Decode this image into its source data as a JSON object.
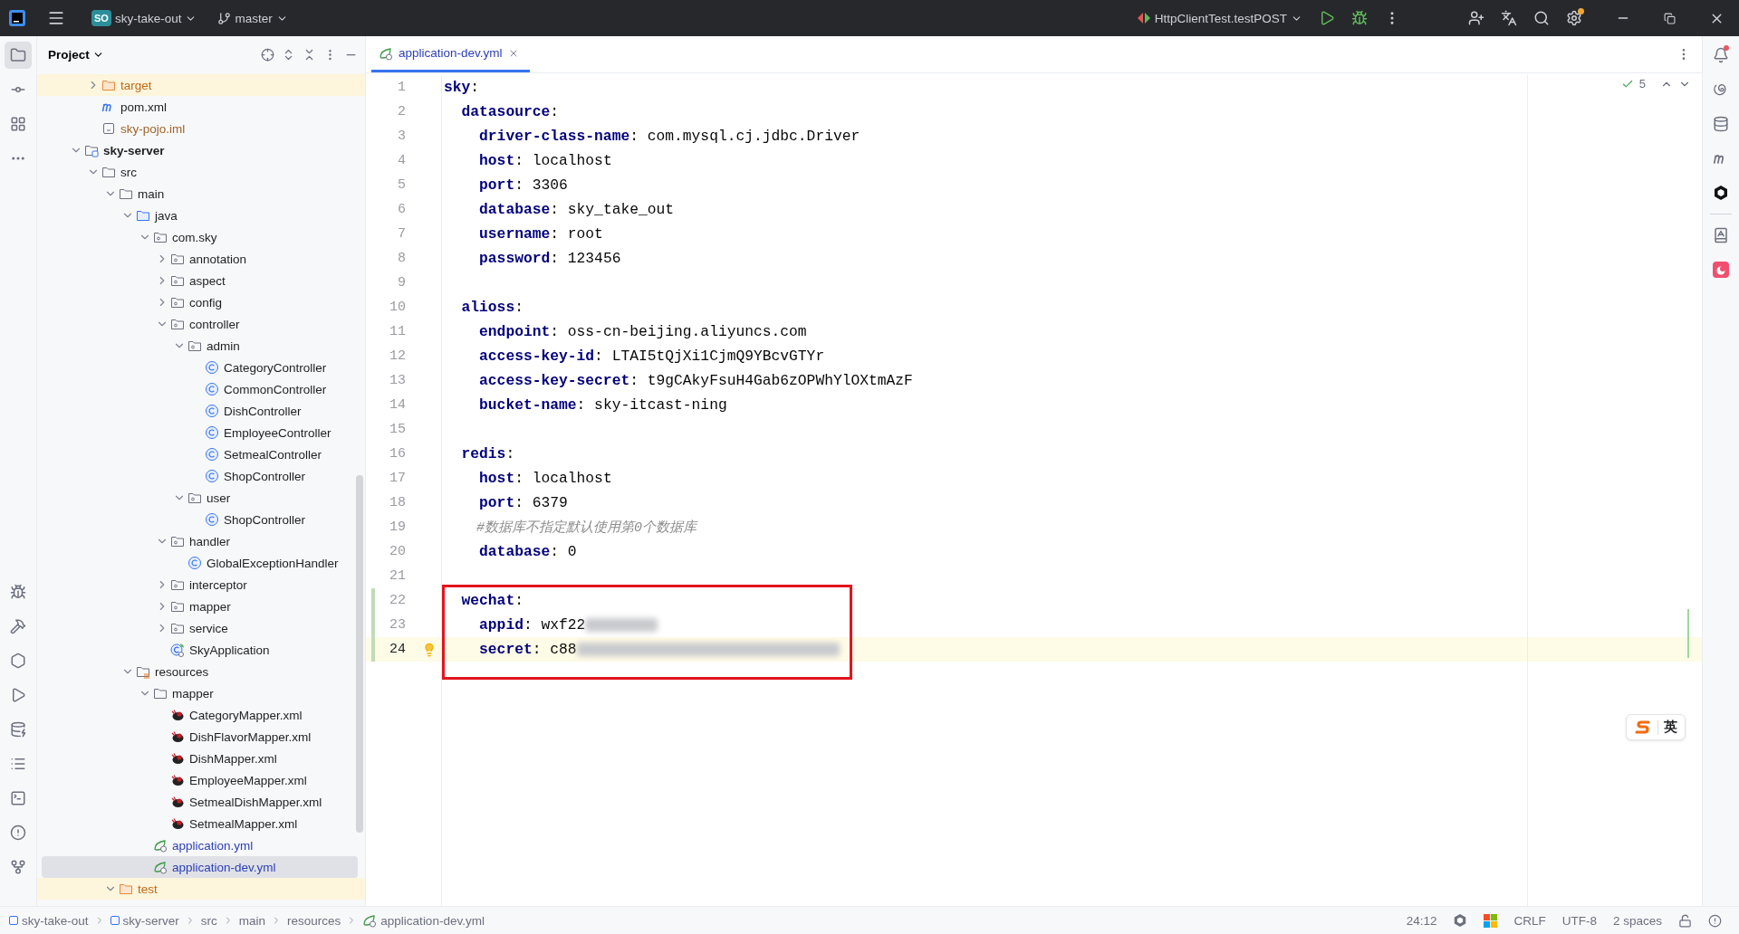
{
  "title_bar": {
    "project_badge": "SO",
    "project": "sky-take-out",
    "branch": "master",
    "run_config": "HttpClientTest.testPOST",
    "settings_badge": true
  },
  "project_panel": {
    "title": "Project"
  },
  "tree": [
    {
      "kind": "hidden-parent",
      "children": [
        {
          "label": "target",
          "kind": "folder",
          "excluded": true,
          "expanded": false,
          "selected": false
        },
        {
          "label": "pom.xml",
          "kind": "maven",
          "selected": false
        },
        {
          "label": "sky-pojo.iml",
          "kind": "iml",
          "selected": false
        }
      ]
    },
    {
      "label": "sky-server",
      "kind": "module",
      "expanded": true,
      "selected": false,
      "children": [
        {
          "label": "src",
          "kind": "folder",
          "expanded": true,
          "selected": false,
          "children": [
            {
              "label": "main",
              "kind": "folder",
              "expanded": true,
              "selected": false,
              "children": [
                {
                  "label": "java",
                  "kind": "source",
                  "expanded": true,
                  "selected": false,
                  "children": [
                    {
                      "label": "com.sky",
                      "kind": "package",
                      "expanded": true,
                      "selected": false,
                      "children": [
                        {
                          "label": "annotation",
                          "kind": "package",
                          "expanded": false,
                          "selected": false
                        },
                        {
                          "label": "aspect",
                          "kind": "package",
                          "expanded": false,
                          "selected": false
                        },
                        {
                          "label": "config",
                          "kind": "package",
                          "expanded": false,
                          "selected": false
                        },
                        {
                          "label": "controller",
                          "kind": "package",
                          "expanded": true,
                          "selected": false,
                          "children": [
                            {
                              "label": "admin",
                              "kind": "package",
                              "expanded": true,
                              "selected": false,
                              "children": [
                                {
                                  "label": "CategoryController",
                                  "kind": "class",
                                  "selected": false
                                },
                                {
                                  "label": "CommonController",
                                  "kind": "class",
                                  "selected": false
                                },
                                {
                                  "label": "DishController",
                                  "kind": "class",
                                  "selected": false
                                },
                                {
                                  "label": "EmployeeController",
                                  "kind": "class",
                                  "selected": false
                                },
                                {
                                  "label": "SetmealController",
                                  "kind": "class",
                                  "selected": false
                                },
                                {
                                  "label": "ShopController",
                                  "kind": "class",
                                  "selected": false
                                }
                              ]
                            },
                            {
                              "label": "user",
                              "kind": "package",
                              "expanded": true,
                              "selected": false,
                              "children": [
                                {
                                  "label": "ShopController",
                                  "kind": "class",
                                  "selected": false
                                }
                              ]
                            }
                          ]
                        },
                        {
                          "label": "handler",
                          "kind": "package",
                          "expanded": true,
                          "selected": false,
                          "children": [
                            {
                              "label": "GlobalExceptionHandler",
                              "kind": "class",
                              "selected": false
                            }
                          ]
                        },
                        {
                          "label": "interceptor",
                          "kind": "package",
                          "expanded": false,
                          "selected": false
                        },
                        {
                          "label": "mapper",
                          "kind": "package",
                          "expanded": false,
                          "selected": false
                        },
                        {
                          "label": "service",
                          "kind": "package",
                          "expanded": false,
                          "selected": false
                        },
                        {
                          "label": "SkyApplication",
                          "kind": "app",
                          "selected": false
                        }
                      ]
                    }
                  ]
                },
                {
                  "label": "resources",
                  "kind": "resources",
                  "expanded": true,
                  "selected": false,
                  "children": [
                    {
                      "label": "mapper",
                      "kind": "folder",
                      "expanded": true,
                      "selected": false,
                      "children": [
                        {
                          "label": "CategoryMapper.xml",
                          "kind": "mybatis",
                          "selected": false
                        },
                        {
                          "label": "DishFlavorMapper.xml",
                          "kind": "mybatis",
                          "selected": false
                        },
                        {
                          "label": "DishMapper.xml",
                          "kind": "mybatis",
                          "selected": false
                        },
                        {
                          "label": "EmployeeMapper.xml",
                          "kind": "mybatis",
                          "selected": false
                        },
                        {
                          "label": "SetmealDishMapper.xml",
                          "kind": "mybatis",
                          "selected": false
                        },
                        {
                          "label": "SetmealMapper.xml",
                          "kind": "mybatis",
                          "selected": false
                        }
                      ]
                    },
                    {
                      "label": "application.yml",
                      "kind": "yml",
                      "selected": false
                    },
                    {
                      "label": "application-dev.yml",
                      "kind": "yml",
                      "selected": true
                    }
                  ]
                }
              ]
            },
            {
              "label": "test",
              "kind": "folder",
              "excluded": true,
              "expanded": true,
              "selected": false
            }
          ]
        }
      ]
    }
  ],
  "tabs": [
    {
      "label": "application-dev.yml",
      "selected": true
    }
  ],
  "inspection": {
    "count": "5"
  },
  "code": [
    {
      "number": "1",
      "tokens": [
        {
          "kind": "key",
          "text": "sky"
        },
        {
          "kind": "punct",
          "text": ":"
        }
      ]
    },
    {
      "number": "2",
      "tokens": [
        {
          "kind": "key",
          "text": "  datasource"
        },
        {
          "kind": "punct",
          "text": ":"
        }
      ]
    },
    {
      "number": "3",
      "tokens": [
        {
          "kind": "key",
          "text": "    driver-class-name"
        },
        {
          "kind": "punct",
          "text": ":"
        },
        {
          "kind": "value",
          "text": " com.mysql.cj.jdbc.Driver"
        }
      ]
    },
    {
      "number": "4",
      "tokens": [
        {
          "kind": "key",
          "text": "    host"
        },
        {
          "kind": "punct",
          "text": ":"
        },
        {
          "kind": "value",
          "text": " localhost"
        }
      ]
    },
    {
      "number": "5",
      "tokens": [
        {
          "kind": "key",
          "text": "    port"
        },
        {
          "kind": "punct",
          "text": ":"
        },
        {
          "kind": "value",
          "text": " 3306"
        }
      ]
    },
    {
      "number": "6",
      "tokens": [
        {
          "kind": "key",
          "text": "    database"
        },
        {
          "kind": "punct",
          "text": ":"
        },
        {
          "kind": "value",
          "text": " sky_take_out"
        }
      ]
    },
    {
      "number": "7",
      "tokens": [
        {
          "kind": "key",
          "text": "    username"
        },
        {
          "kind": "punct",
          "text": ":"
        },
        {
          "kind": "value",
          "text": " root"
        }
      ]
    },
    {
      "number": "8",
      "tokens": [
        {
          "kind": "key",
          "text": "    password"
        },
        {
          "kind": "punct",
          "text": ":"
        },
        {
          "kind": "value",
          "text": " 123456"
        }
      ]
    },
    {
      "number": "9"
    },
    {
      "number": "10",
      "tokens": [
        {
          "kind": "key",
          "text": "  alioss"
        },
        {
          "kind": "punct",
          "text": ":"
        }
      ]
    },
    {
      "number": "11",
      "tokens": [
        {
          "kind": "key",
          "text": "    endpoint"
        },
        {
          "kind": "punct",
          "text": ":"
        },
        {
          "kind": "value",
          "text": " oss-cn-beijing.aliyuncs.com"
        }
      ]
    },
    {
      "number": "12",
      "tokens": [
        {
          "kind": "key",
          "text": "    access-key-id"
        },
        {
          "kind": "punct",
          "text": ":"
        },
        {
          "kind": "value",
          "text": " LTAI5tQjXi1CjmQ9YBcvGTYr"
        }
      ]
    },
    {
      "number": "13",
      "tokens": [
        {
          "kind": "key",
          "text": "    access-key-secret"
        },
        {
          "kind": "punct",
          "text": ":"
        },
        {
          "kind": "value",
          "text": " t9gCAkyFsuH4Gab6zOPWhYlOXtmAzF"
        }
      ]
    },
    {
      "number": "14",
      "tokens": [
        {
          "kind": "key",
          "text": "    bucket-name"
        },
        {
          "kind": "punct",
          "text": ":"
        },
        {
          "kind": "value",
          "text": " sky-itcast-ning"
        }
      ]
    },
    {
      "number": "15"
    },
    {
      "number": "16",
      "tokens": [
        {
          "kind": "key",
          "text": "  redis"
        },
        {
          "kind": "punct",
          "text": ":"
        }
      ]
    },
    {
      "number": "17",
      "tokens": [
        {
          "kind": "key",
          "text": "    host"
        },
        {
          "kind": "punct",
          "text": ":"
        },
        {
          "kind": "value",
          "text": " localhost"
        }
      ]
    },
    {
      "number": "18",
      "tokens": [
        {
          "kind": "key",
          "text": "    port"
        },
        {
          "kind": "punct",
          "text": ":"
        },
        {
          "kind": "value",
          "text": " 6379"
        }
      ]
    },
    {
      "number": "19",
      "tokens": [
        {
          "kind": "comment",
          "text": "    #数据库不指定默认使用第0个数据库"
        }
      ]
    },
    {
      "number": "20",
      "tokens": [
        {
          "kind": "key",
          "text": "    database"
        },
        {
          "kind": "punct",
          "text": ":"
        },
        {
          "kind": "value",
          "text": " 0"
        }
      ]
    },
    {
      "number": "21"
    },
    {
      "number": "22",
      "changed": true,
      "boxed": true,
      "tokens": [
        {
          "kind": "key",
          "text": "  wechat"
        },
        {
          "kind": "punct",
          "text": ":"
        }
      ]
    },
    {
      "number": "23",
      "changed": true,
      "boxed": true,
      "tokens": [
        {
          "kind": "key",
          "text": "    appid"
        },
        {
          "kind": "punct",
          "text": ":"
        },
        {
          "kind": "value",
          "text": " wxf22"
        },
        {
          "kind": "redacted-short"
        }
      ]
    },
    {
      "number": "24",
      "changed": true,
      "boxed": true,
      "current": true,
      "tokens": [
        {
          "kind": "key",
          "text": "    secret"
        },
        {
          "kind": "punct",
          "text": ":"
        },
        {
          "kind": "value",
          "text": " c88"
        },
        {
          "kind": "redacted-long"
        }
      ]
    }
  ],
  "ime": {
    "label": "英"
  },
  "breadcrumbs": [
    {
      "label": "sky-take-out",
      "kind": "module"
    },
    {
      "label": "sky-server",
      "kind": "module"
    },
    {
      "label": "src",
      "kind": "plain"
    },
    {
      "label": "main",
      "kind": "plain"
    },
    {
      "label": "resources",
      "kind": "plain"
    },
    {
      "label": "application-dev.yml",
      "kind": "yml"
    }
  ],
  "status": {
    "position": "24:12",
    "line_ending": "CRLF",
    "encoding": "UTF-8",
    "indent": "2 spaces"
  }
}
